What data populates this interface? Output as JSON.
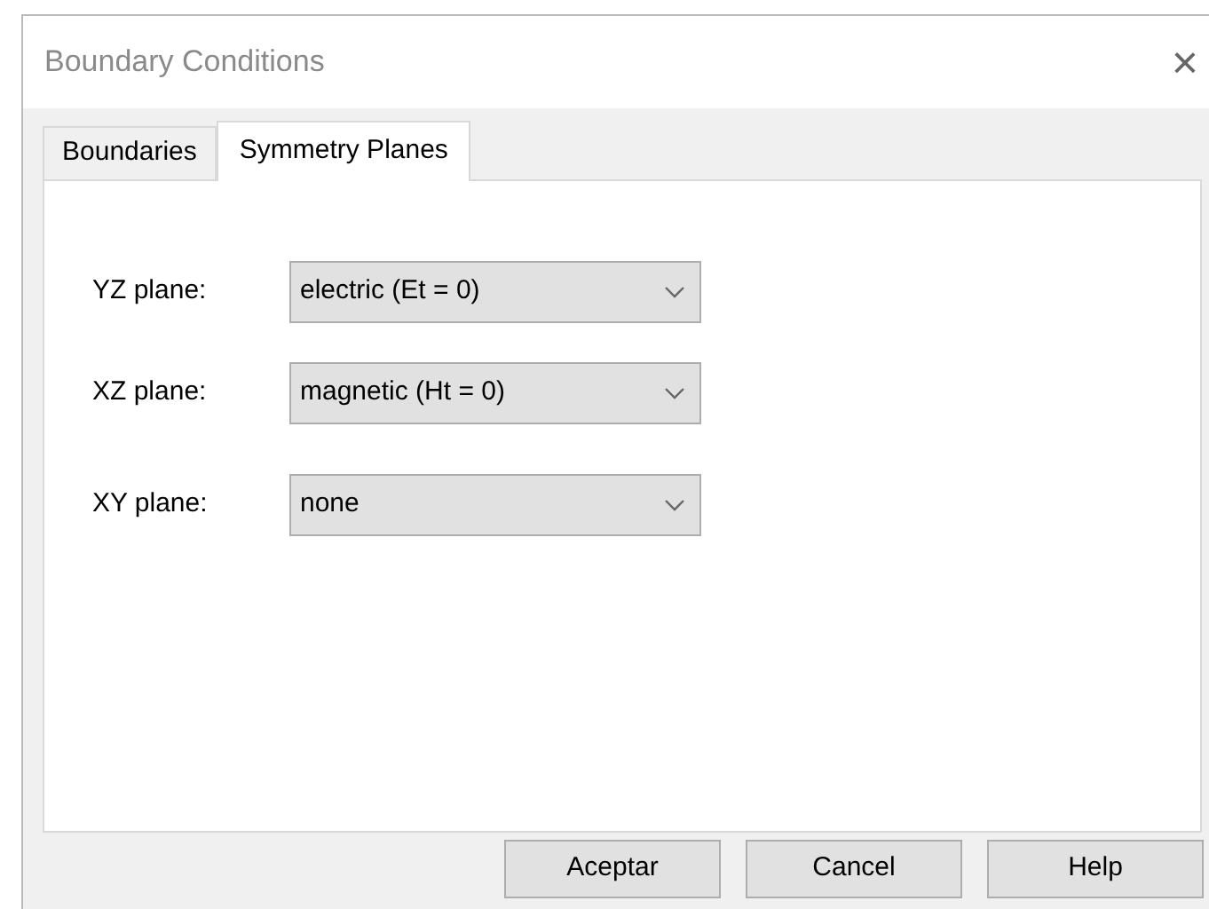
{
  "window": {
    "title": "Boundary Conditions",
    "close": "×"
  },
  "tabs": [
    {
      "label": "Boundaries",
      "selected": false
    },
    {
      "label": "Symmetry Planes",
      "selected": true
    }
  ],
  "planes": [
    {
      "label": "YZ plane:",
      "value": "electric (Et = 0)"
    },
    {
      "label": "XZ plane:",
      "value": "magnetic (Ht = 0)"
    },
    {
      "label": "XY plane:",
      "value": "none"
    }
  ],
  "buttons": [
    "Aceptar",
    "Cancel",
    "Help"
  ]
}
